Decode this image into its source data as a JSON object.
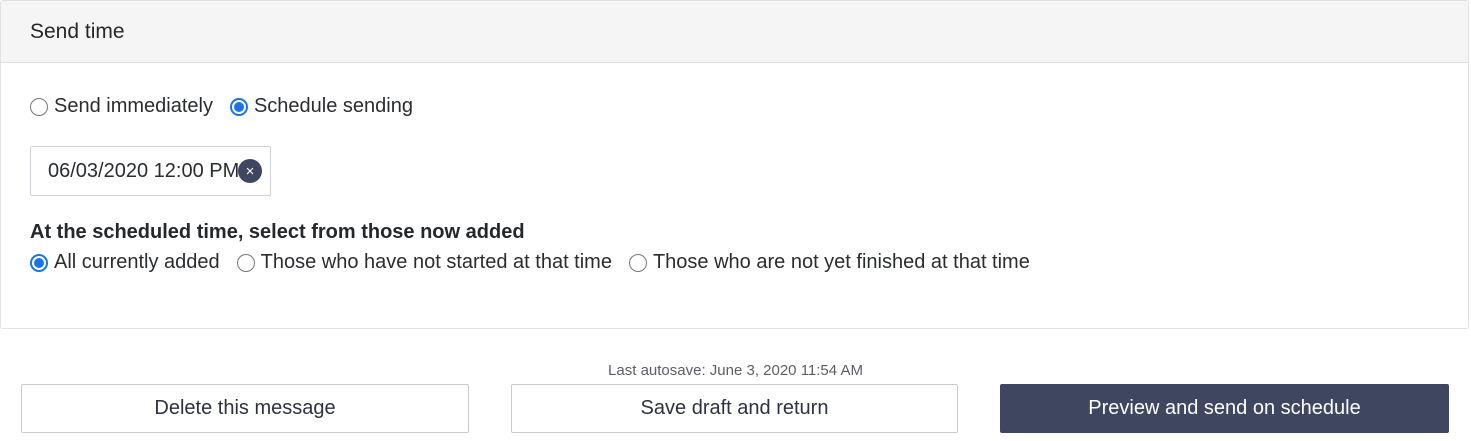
{
  "panel": {
    "title": "Send time"
  },
  "send_mode": {
    "options": [
      {
        "label": "Send immediately",
        "checked": false
      },
      {
        "label": "Schedule sending",
        "checked": true
      }
    ]
  },
  "schedule": {
    "datetime_value": "06/03/2020 12:00 PM",
    "clear_icon": "×"
  },
  "recipients": {
    "heading": "At the scheduled time, select from those now added",
    "options": [
      {
        "label": "All currently added",
        "checked": true
      },
      {
        "label": "Those who have not started at that time",
        "checked": false
      },
      {
        "label": "Those who are not yet finished at that time",
        "checked": false
      }
    ]
  },
  "footer": {
    "autosave": "Last autosave: June 3, 2020 11:54 AM",
    "delete_label": "Delete this message",
    "save_label": "Save draft and return",
    "preview_label": "Preview and send on schedule"
  },
  "colors": {
    "accent": "#1a73e8",
    "primary_button": "#3f4660",
    "header_bg": "#f5f5f5"
  }
}
